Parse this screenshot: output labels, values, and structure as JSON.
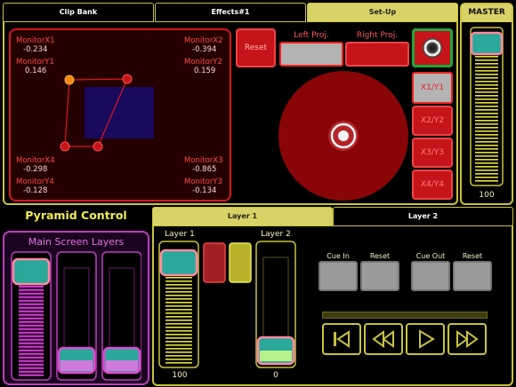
{
  "tabs": [
    {
      "label": "Clip Bank"
    },
    {
      "label": "Effects#1"
    },
    {
      "label": "Set-Up"
    }
  ],
  "master": {
    "title": "MASTER",
    "value": "100"
  },
  "monitor": {
    "x1": {
      "label": "MonitorX1",
      "value": "-0.234"
    },
    "y1": {
      "label": "MonitorY1",
      "value": "0.146"
    },
    "x2": {
      "label": "MonitorX2",
      "value": "-0.394"
    },
    "y2": {
      "label": "MonitorY2",
      "value": "0.159"
    },
    "x4": {
      "label": "MonitorX4",
      "value": "-0.298"
    },
    "y4": {
      "label": "MonitorY4",
      "value": "-0.128"
    },
    "x3": {
      "label": "MonitorX3",
      "value": "-0.865"
    },
    "y3": {
      "label": "MonitorY3",
      "value": "-0.134"
    }
  },
  "setup": {
    "reset": "Reset",
    "left_proj": "Left Proj.",
    "right_proj": "Right Proj.",
    "xy": [
      "X1/Y1",
      "X2/Y2",
      "X3/Y3",
      "X4/Y4"
    ]
  },
  "pyramid": {
    "title": "Pyramid Control",
    "layers_title": "Main Screen Layers"
  },
  "layer_tabs": [
    {
      "label": "Layer 1"
    },
    {
      "label": "Layer 2"
    }
  ],
  "layers": {
    "layer1": {
      "label": "Layer 1",
      "value": "100"
    },
    "layer2": {
      "label": "Layer 2",
      "value": "0"
    }
  },
  "cue": {
    "cue_in": "Cue In",
    "reset1": "Reset",
    "cue_out": "Cue Out",
    "reset2": "Reset"
  },
  "colors": {
    "accent": "#c9c240",
    "red": "#e0161c",
    "magenta": "#c03cc0"
  }
}
